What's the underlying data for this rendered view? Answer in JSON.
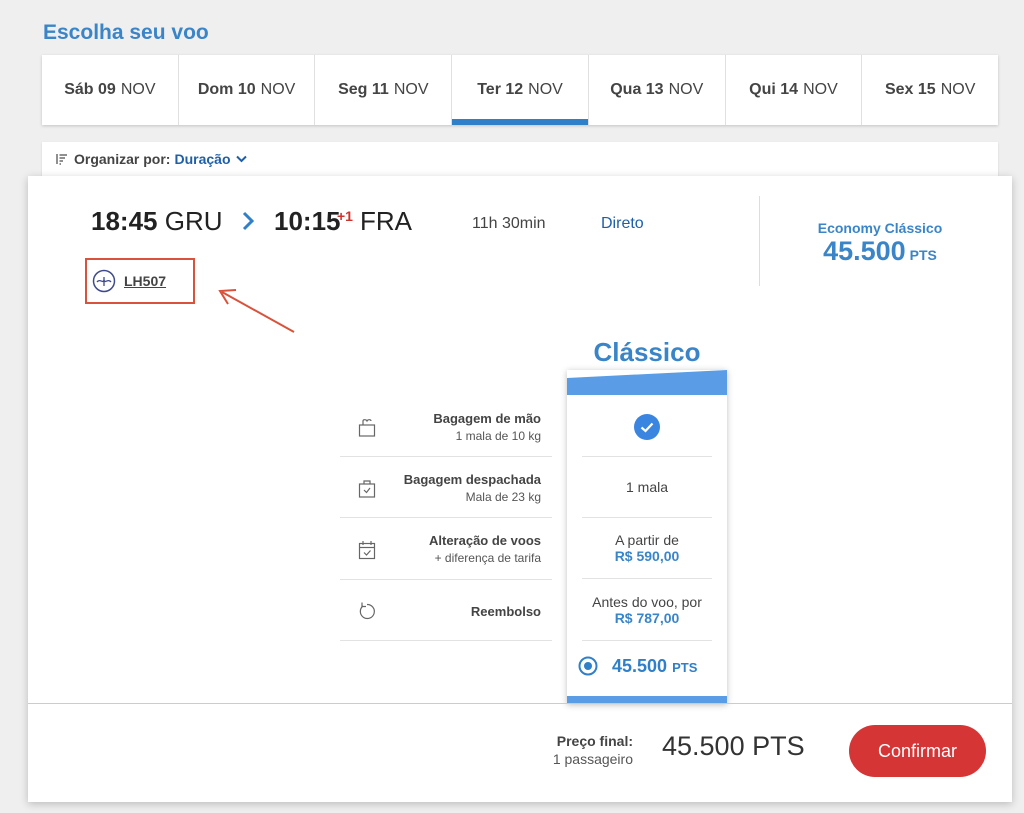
{
  "page_title": "Escolha seu voo",
  "date_tabs": [
    {
      "day": "Sáb 09",
      "month": "NOV"
    },
    {
      "day": "Dom 10",
      "month": "NOV"
    },
    {
      "day": "Seg 11",
      "month": "NOV"
    },
    {
      "day": "Ter 12",
      "month": "NOV",
      "active": true
    },
    {
      "day": "Qua 13",
      "month": "NOV"
    },
    {
      "day": "Qui 14",
      "month": "NOV"
    },
    {
      "day": "Sex 15",
      "month": "NOV"
    }
  ],
  "sort": {
    "label": "Organizar por:",
    "value": "Duração"
  },
  "flight": {
    "dep_time": "18:45",
    "dep_airport": "GRU",
    "arr_time": "10:15",
    "arr_day_offset": "+1",
    "arr_airport": "FRA",
    "duration": "11h 30min",
    "stops": "Direto",
    "flight_number": "LH507",
    "fare_class": "Economy Clássico",
    "fare_price": "45.500",
    "fare_unit": "PTS"
  },
  "fare_column": {
    "title": "Clássico",
    "baggage_cabin": "",
    "baggage_checked": "1 mala",
    "change_prefix": "A partir de",
    "change_price": "R$ 590,00",
    "refund_prefix": "Antes do voo, por",
    "refund_price": "R$ 787,00",
    "points_price": "45.500",
    "points_unit": "PTS"
  },
  "features": [
    {
      "name": "Bagagem de mão",
      "sub": "1 mala de 10 kg"
    },
    {
      "name": "Bagagem despachada",
      "sub": "Mala de 23 kg"
    },
    {
      "name": "Alteração de voos",
      "sub": "+ diferença de tarifa"
    },
    {
      "name": "Reembolso",
      "sub": ""
    }
  ],
  "footer": {
    "final_label": "Preço final:",
    "passengers": "1 passageiro",
    "final_price": "45.500 PTS",
    "confirm_label": "Confirmar"
  },
  "colors": {
    "primary_blue": "#3a85c8",
    "dark_blue": "#1e5fa8",
    "confirm_red": "#d63535",
    "annotation_red": "#d9533c"
  }
}
